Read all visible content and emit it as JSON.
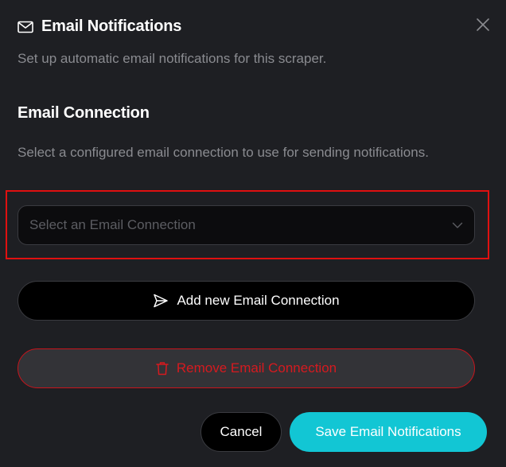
{
  "dialog": {
    "title": "Email Notifications",
    "title_icon": "mail-icon",
    "close_icon": "close-icon",
    "subtitle": "Set up automatic email notifications for this scraper."
  },
  "email_connection": {
    "heading": "Email Connection",
    "description": "Select a configured email connection to use for sending notifications.",
    "select": {
      "placeholder": "Select an Email Connection",
      "value": "",
      "icon": "chevron-down-icon"
    },
    "add_button": {
      "label": "Add new Email Connection",
      "icon": "send-icon"
    },
    "remove_button": {
      "label": "Remove Email Connection",
      "icon": "trash-icon"
    }
  },
  "footer": {
    "cancel_label": "Cancel",
    "save_label": "Save Email Notifications"
  },
  "colors": {
    "background": "#1e1f23",
    "accent": "#12c6d4",
    "danger": "#d61a1f",
    "highlight": "#e01010",
    "muted_text": "#8a8b90"
  }
}
